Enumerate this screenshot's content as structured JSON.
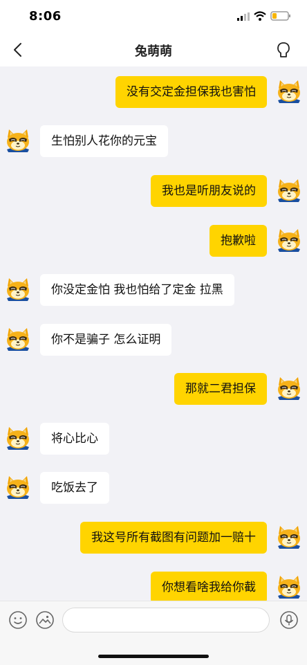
{
  "status_bar": {
    "time": "8:06"
  },
  "header": {
    "title": "兔萌萌"
  },
  "messages": [
    {
      "side": "right",
      "text": "没有交定金担保我也害怕"
    },
    {
      "side": "left",
      "text": "生怕别人花你的元宝"
    },
    {
      "side": "right",
      "text": "我也是听朋友说的"
    },
    {
      "side": "right",
      "text": "抱歉啦"
    },
    {
      "side": "left",
      "text": "你没定金怕  我也怕给了定金 拉黑"
    },
    {
      "side": "left",
      "text": "你不是骗子 怎么证明"
    },
    {
      "side": "right",
      "text": "那就二君担保"
    },
    {
      "side": "left",
      "text": "将心比心"
    },
    {
      "side": "left",
      "text": "吃饭去了"
    },
    {
      "side": "right",
      "text": "我这号所有截图有问题加一赔十"
    },
    {
      "side": "right",
      "text": "你想看啥我给你截"
    }
  ],
  "input": {
    "placeholder": ""
  },
  "icons": {
    "back": "chevron-left-icon",
    "profile": "profile-icon",
    "emoji": "emoji-icon",
    "image": "image-icon",
    "voice": "microphone-icon"
  },
  "colors": {
    "my_bubble": "#ffd400",
    "other_bubble": "#ffffff",
    "chat_bg": "#f2f2f6"
  }
}
